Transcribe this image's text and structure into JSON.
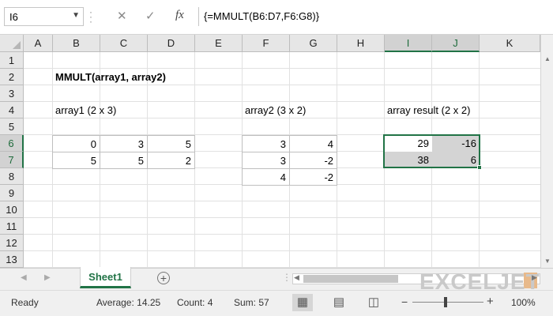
{
  "name_box": "I6",
  "formula": "{=MMULT(B6:D7,F6:G8)}",
  "fx_label": "fx",
  "columns": [
    "A",
    "B",
    "C",
    "D",
    "E",
    "F",
    "G",
    "H",
    "I",
    "J",
    "K"
  ],
  "rows": [
    "1",
    "2",
    "3",
    "4",
    "5",
    "6",
    "7",
    "8",
    "9",
    "10",
    "11",
    "12",
    "13"
  ],
  "selected_columns": [
    "I",
    "J"
  ],
  "selected_rows": [
    "6",
    "7"
  ],
  "title": "MMULT(array1, array2)",
  "array1_label": "array1 (2 x 3)",
  "array2_label": "array2 (3 x 2)",
  "result_label": "array result (2 x 2)",
  "array1": [
    [
      "0",
      "3",
      "5"
    ],
    [
      "5",
      "5",
      "2"
    ]
  ],
  "array2": [
    [
      "3",
      "4"
    ],
    [
      "3",
      "-2"
    ],
    [
      "4",
      "-2"
    ]
  ],
  "result": [
    [
      "29",
      "-16"
    ],
    [
      "38",
      "6"
    ]
  ],
  "sheet_tab": "Sheet1",
  "watermark": "EXCELJET",
  "status": {
    "mode": "Ready",
    "average": "Average: 14.25",
    "count": "Count: 4",
    "sum": "Sum: 57",
    "zoom": "100%"
  },
  "icons": [
    "cancel-icon",
    "enter-icon",
    "function-icon",
    "add-sheet-icon",
    "normal-view-icon",
    "page-layout-icon",
    "page-break-icon"
  ]
}
